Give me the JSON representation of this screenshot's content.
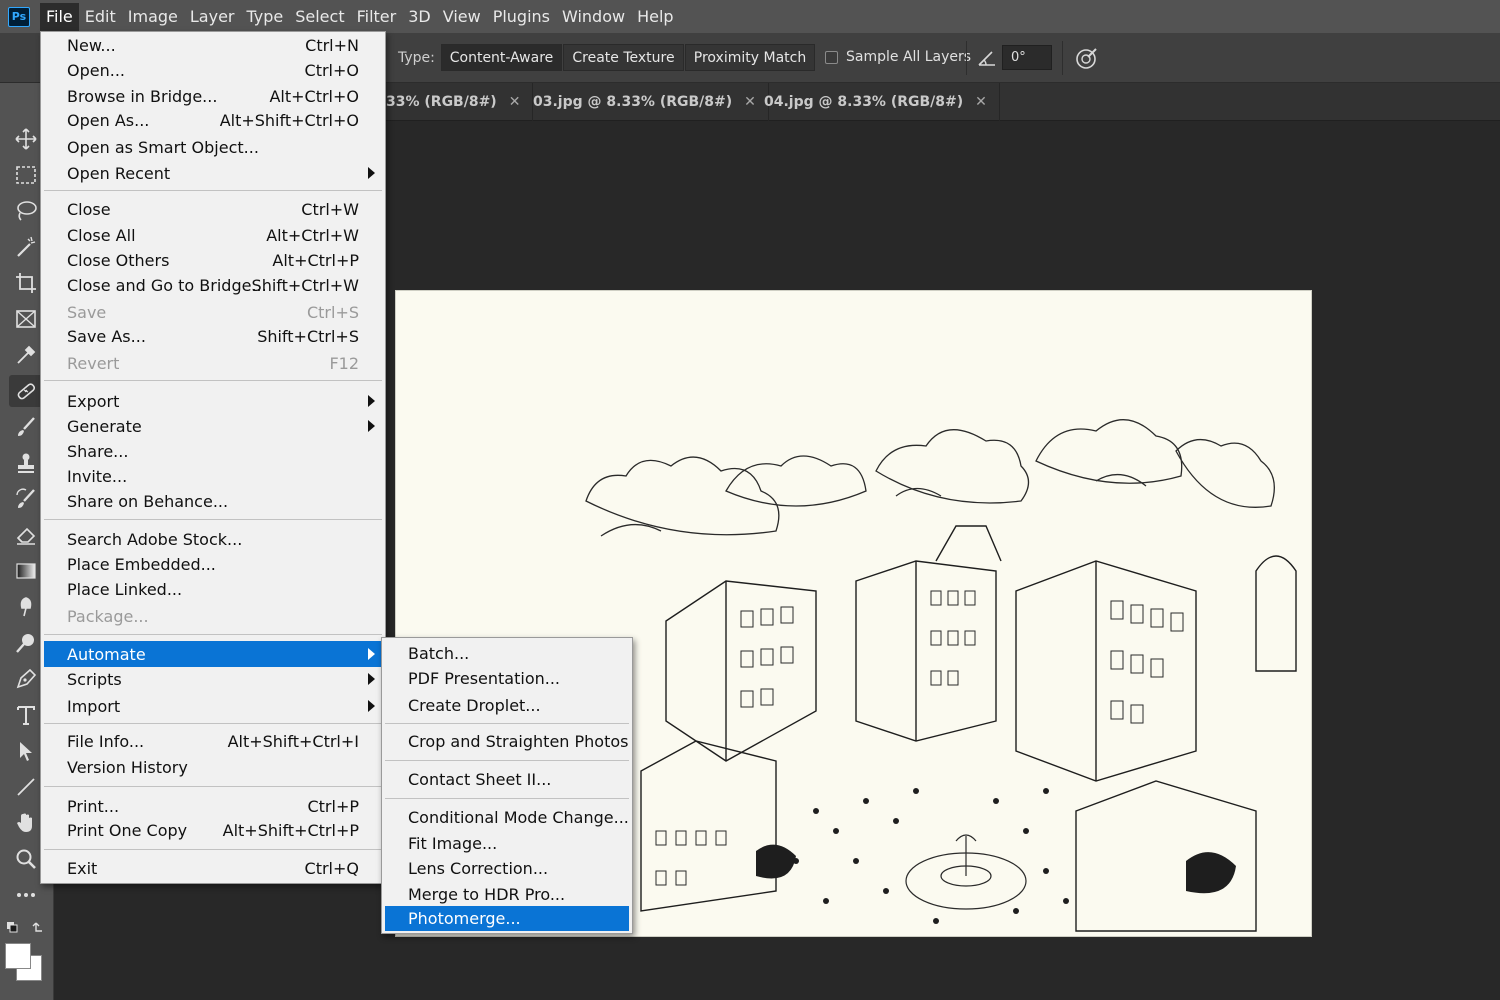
{
  "app": {
    "logo": "Ps"
  },
  "menubar": [
    "File",
    "Edit",
    "Image",
    "Layer",
    "Type",
    "Select",
    "Filter",
    "3D",
    "View",
    "Plugins",
    "Window",
    "Help"
  ],
  "options": {
    "type_label": "Type:",
    "type_buttons": [
      "Content-Aware",
      "Create Texture",
      "Proximity Match"
    ],
    "sample_all_layers": "Sample All Layers",
    "angle_value": "0°"
  },
  "tabs": [
    {
      "title": "33% (RGB/8#)"
    },
    {
      "title": "03.jpg @ 8.33% (RGB/8#)"
    },
    {
      "title": "04.jpg @ 8.33% (RGB/8#)"
    }
  ],
  "file_menu": {
    "new": {
      "label": "New...",
      "shortcut": "Ctrl+N"
    },
    "open": {
      "label": "Open...",
      "shortcut": "Ctrl+O"
    },
    "browse_bridge": {
      "label": "Browse in Bridge...",
      "shortcut": "Alt+Ctrl+O"
    },
    "open_as": {
      "label": "Open As...",
      "shortcut": "Alt+Shift+Ctrl+O"
    },
    "open_smart": {
      "label": "Open as Smart Object..."
    },
    "open_recent": {
      "label": "Open Recent"
    },
    "close": {
      "label": "Close",
      "shortcut": "Ctrl+W"
    },
    "close_all": {
      "label": "Close All",
      "shortcut": "Alt+Ctrl+W"
    },
    "close_others": {
      "label": "Close Others",
      "shortcut": "Alt+Ctrl+P"
    },
    "close_go_bridge": {
      "label": "Close and Go to Bridge...",
      "shortcut": "Shift+Ctrl+W"
    },
    "save": {
      "label": "Save",
      "shortcut": "Ctrl+S"
    },
    "save_as": {
      "label": "Save As...",
      "shortcut": "Shift+Ctrl+S"
    },
    "revert": {
      "label": "Revert",
      "shortcut": "F12"
    },
    "export": {
      "label": "Export"
    },
    "generate": {
      "label": "Generate"
    },
    "share": {
      "label": "Share..."
    },
    "invite": {
      "label": "Invite..."
    },
    "share_behance": {
      "label": "Share on Behance..."
    },
    "search_stock": {
      "label": "Search Adobe Stock..."
    },
    "place_embedded": {
      "label": "Place Embedded..."
    },
    "place_linked": {
      "label": "Place Linked..."
    },
    "package": {
      "label": "Package..."
    },
    "automate": {
      "label": "Automate"
    },
    "scripts": {
      "label": "Scripts"
    },
    "import": {
      "label": "Import"
    },
    "file_info": {
      "label": "File Info...",
      "shortcut": "Alt+Shift+Ctrl+I"
    },
    "version_history": {
      "label": "Version History"
    },
    "print": {
      "label": "Print...",
      "shortcut": "Ctrl+P"
    },
    "print_one": {
      "label": "Print One Copy",
      "shortcut": "Alt+Shift+Ctrl+P"
    },
    "exit": {
      "label": "Exit",
      "shortcut": "Ctrl+Q"
    }
  },
  "automate_menu": {
    "batch": "Batch...",
    "pdf_presentation": "PDF Presentation...",
    "create_droplet": "Create Droplet...",
    "crop_straighten": "Crop and Straighten Photos",
    "contact_sheet": "Contact Sheet II...",
    "conditional_mode": "Conditional Mode Change...",
    "fit_image": "Fit Image...",
    "lens_correction": "Lens Correction...",
    "merge_hdr": "Merge to HDR Pro...",
    "photomerge": "Photomerge..."
  },
  "colors": {
    "menu_highlight": "#0a74d5",
    "menubar_bg": "#535353",
    "canvas_bg": "#282828",
    "menu_bg": "#f1f1f1"
  }
}
